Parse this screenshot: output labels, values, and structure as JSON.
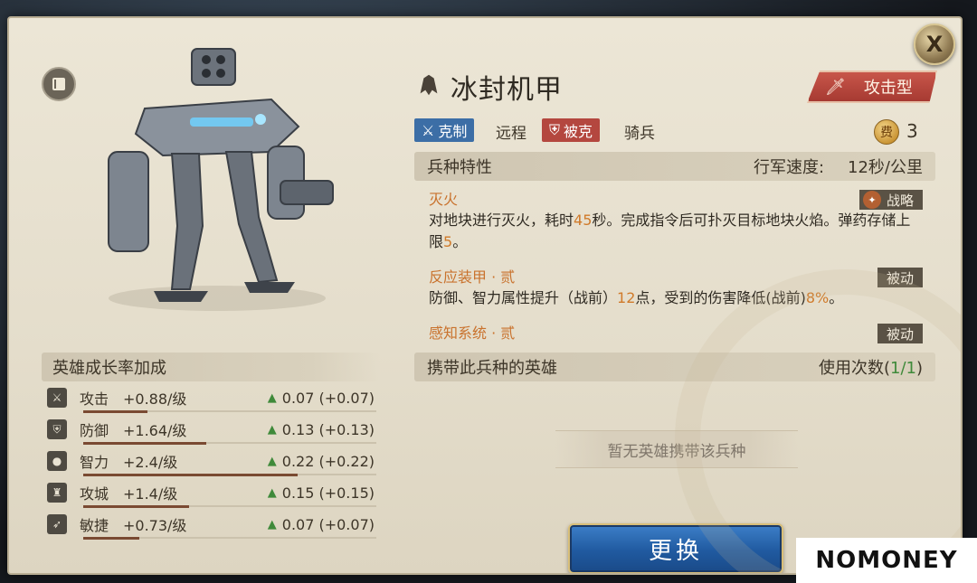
{
  "unit": {
    "name": "冰封机甲",
    "type_label": "攻击型",
    "counter_label": "克制",
    "counter_target": "远程",
    "weak_label": "被克",
    "weak_target": "骑兵",
    "cost_icon_label": "费",
    "cost": "3"
  },
  "growth": {
    "title": "英雄成长率加成",
    "stats": [
      {
        "icon": "sword-icon",
        "name": "攻击",
        "per_level": "+0.88/级",
        "gain": "0.07 (+0.07)",
        "bar": 0.22
      },
      {
        "icon": "shield-icon",
        "name": "防御",
        "per_level": "+1.64/级",
        "gain": "0.13 (+0.13)",
        "bar": 0.42
      },
      {
        "icon": "head-icon",
        "name": "智力",
        "per_level": "+2.4/级",
        "gain": "0.22 (+0.22)",
        "bar": 0.73
      },
      {
        "icon": "castle-icon",
        "name": "攻城",
        "per_level": "+1.4/级",
        "gain": "0.15 (+0.15)",
        "bar": 0.36
      },
      {
        "icon": "boot-icon",
        "name": "敏捷",
        "per_level": "+0.73/级",
        "gain": "0.07 (+0.07)",
        "bar": 0.19
      }
    ]
  },
  "traits": {
    "title": "兵种特性",
    "speed_label": "行军速度:",
    "speed_value": "12秒/公里",
    "items": [
      {
        "name": "灭火",
        "tag": "战略",
        "desc_a": "对地块进行灭火，耗时",
        "hl_a": "45",
        "desc_b": "秒。完成指令后可扑灭目标地块火焰。弹药存储上限",
        "hl_b": "5",
        "desc_c": "。"
      },
      {
        "name": "反应装甲 · 贰",
        "tag": "被动",
        "desc_a": "防御、智力属性提升（战前）",
        "hl_a": "12",
        "desc_b": "点，受到的伤害降低(战前)",
        "hl_b": "8%",
        "desc_c": "。"
      },
      {
        "name": "感知系统 · 贰",
        "tag": "被动",
        "desc_a": "",
        "hl_a": "",
        "desc_b": "",
        "hl_b": "",
        "desc_c": ""
      }
    ]
  },
  "heroes": {
    "title": "携带此兵种的英雄",
    "usage_label": "使用次数(",
    "usage_value": "1/1",
    "usage_close": ")",
    "empty_text": "暂无英雄携带该兵种"
  },
  "buttons": {
    "replace": "更换",
    "close": "X"
  },
  "watermark": "NOMONEY",
  "colors": {
    "accent_orange": "#d07a2a",
    "counter_blue": "#3c6ea6",
    "weak_red": "#b4473f",
    "type_red": "#a63a32",
    "gain_green": "#3f8a3a",
    "button_blue": "#205aa0"
  }
}
